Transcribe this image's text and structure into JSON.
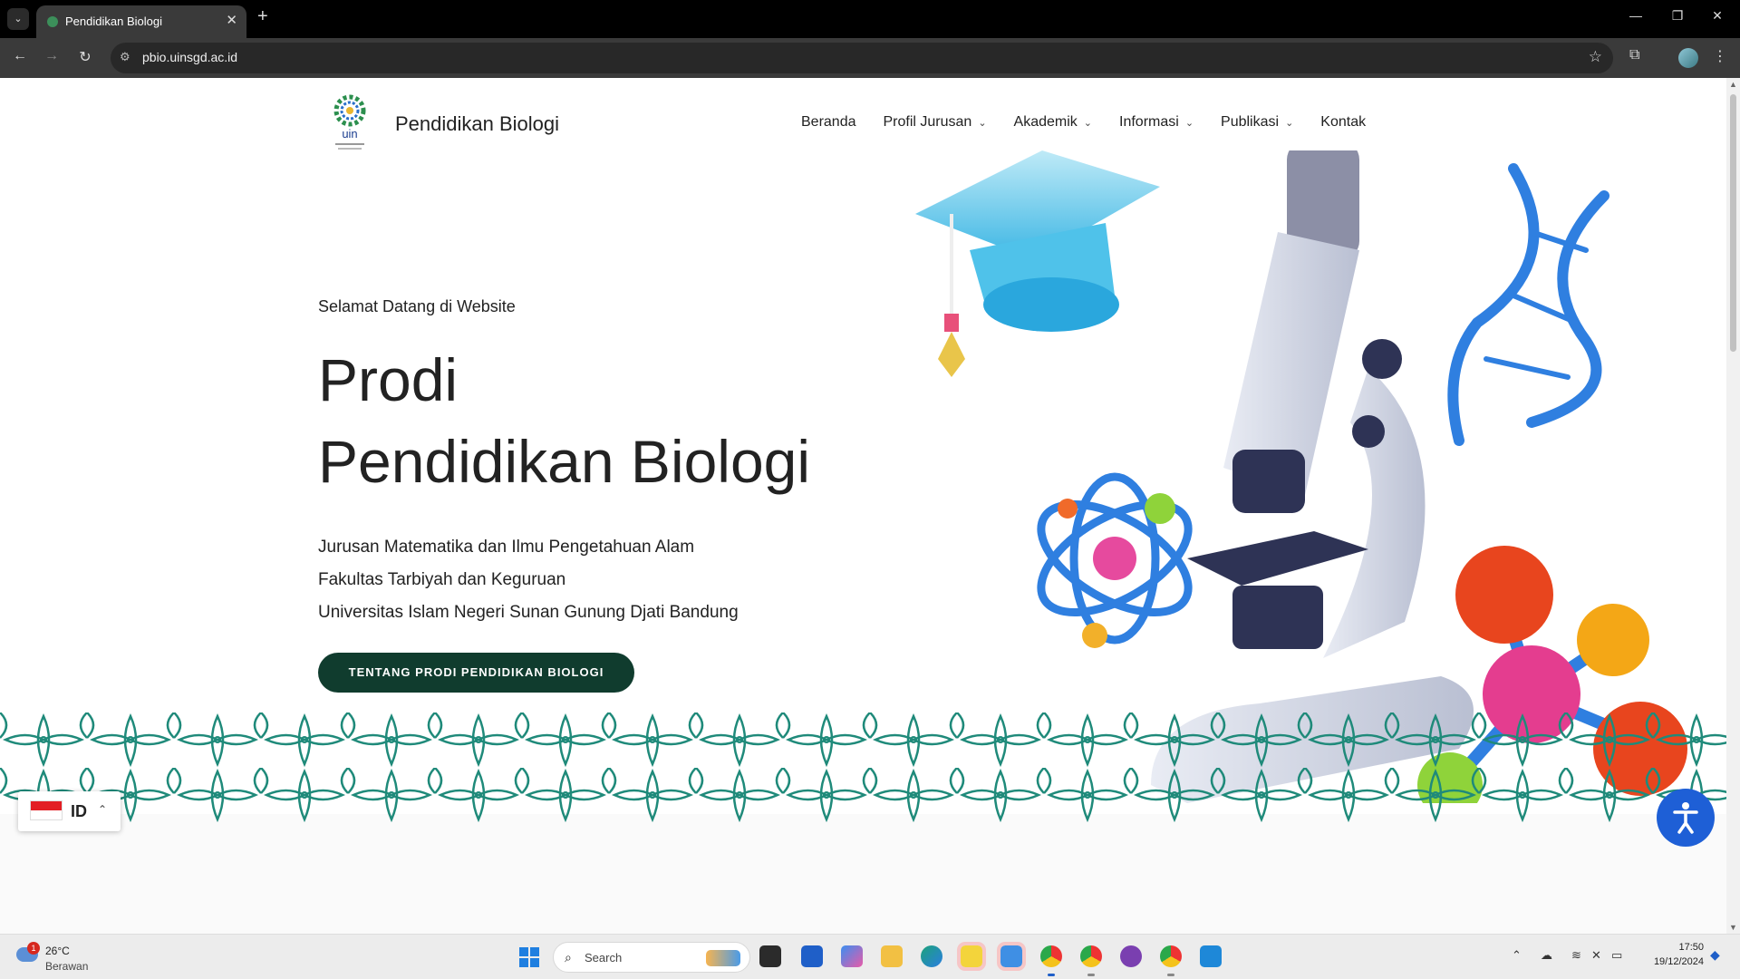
{
  "browser": {
    "tab_title": "Pendidikan Biologi",
    "tab_close": "✕",
    "new_tab": "+",
    "url": "pbio.uinsgd.ac.id",
    "window_controls": [
      "—",
      "❐",
      "✕"
    ]
  },
  "site": {
    "brand": "Pendidikan Biologi",
    "logo_text": "uin",
    "nav": [
      {
        "label": "Beranda",
        "dropdown": false
      },
      {
        "label": "Profil Jurusan",
        "dropdown": true
      },
      {
        "label": "Akademik",
        "dropdown": true
      },
      {
        "label": "Informasi",
        "dropdown": true
      },
      {
        "label": "Publikasi",
        "dropdown": true
      },
      {
        "label": "Kontak",
        "dropdown": false
      }
    ],
    "hero": {
      "welcome": "Selamat Datang di Website",
      "title_line1": "Prodi",
      "title_line2": "Pendidikan Biologi",
      "sub_line1": "Jurusan Matematika dan Ilmu Pengetahuan Alam",
      "sub_line2": "Fakultas Tarbiyah dan Keguruan",
      "sub_line3": "Universitas Islam Negeri Sunan Gunung Djati Bandung",
      "cta": "TENTANG PRODI PENDIDIKAN BIOLOGI"
    },
    "language": {
      "code": "ID"
    },
    "colors": {
      "cta_bg": "#103c2e",
      "pattern": "#1f8a7a",
      "a11y": "#1e5fd6"
    }
  },
  "taskbar": {
    "weather_badge": "1",
    "weather_temp": "26°C",
    "weather_condition": "Berawan",
    "search_placeholder": "Search",
    "time": "17:50",
    "date": "19/12/2024"
  }
}
